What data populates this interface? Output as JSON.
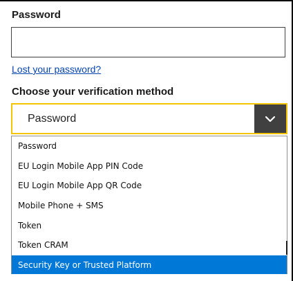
{
  "password_field": {
    "label": "Password",
    "value": ""
  },
  "lost_password_link": "Lost your password?",
  "verification": {
    "label": "Choose your verification method",
    "selected_value": "Password",
    "options": [
      "Password",
      "EU Login Mobile App PIN Code",
      "EU Login Mobile App QR Code",
      "Mobile Phone + SMS",
      "Token",
      "Token CRAM",
      "Security Key or Trusted Platform"
    ],
    "highlighted_option": "Security Key or Trusted Platform"
  },
  "colors": {
    "focus_border": "#f5c400",
    "arrow_button": "#404040",
    "link": "#0645ad",
    "highlight": "#0078d7"
  },
  "icons": {
    "dropdown_arrow": "chevron-down-icon"
  }
}
